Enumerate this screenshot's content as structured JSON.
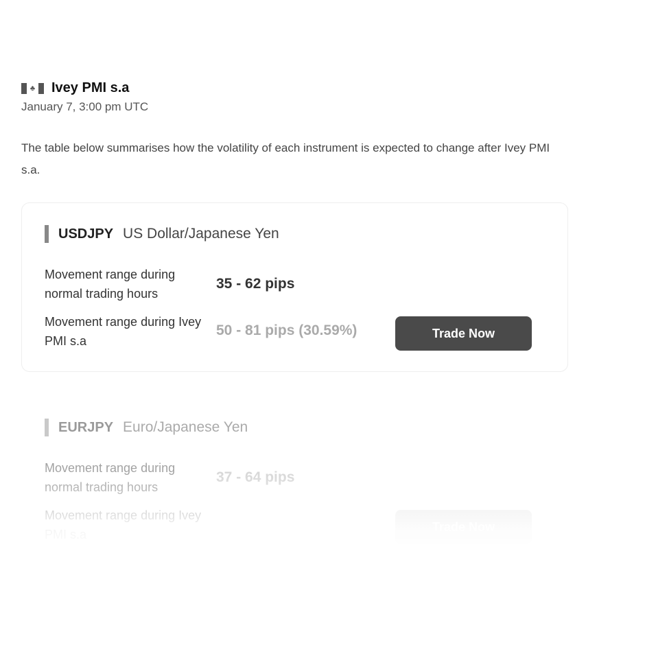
{
  "event": {
    "flag_icon": "canada-flag-icon",
    "flag_glyph": "♣",
    "title": "Ivey PMI s.a",
    "time": "January 7, 3:00 pm UTC"
  },
  "intro": "The table below summarises how the volatility of each instrument is expected to change after Ivey PMI s.a.",
  "instruments": [
    {
      "symbol": "USDJPY",
      "name": "US Dollar/Japanese Yen",
      "normal_label": "Movement range during normal trading hours",
      "normal_value": "35 - 62 pips",
      "event_label": "Movement range during Ivey PMI s.a",
      "event_value": "50 - 81 pips (30.59%)",
      "button_label": "Trade Now"
    },
    {
      "symbol": "EURJPY",
      "name": "Euro/Japanese Yen",
      "normal_label": "Movement range during normal trading hours",
      "normal_value": "37 - 64 pips",
      "event_label": "Movement range during Ivey PMI s.a",
      "event_value": "",
      "button_label": "Trade Now"
    }
  ]
}
